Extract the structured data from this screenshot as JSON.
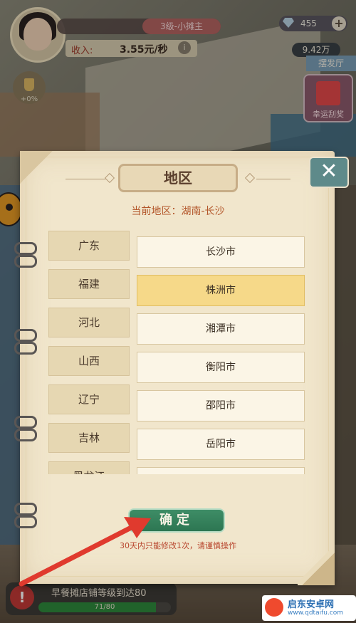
{
  "hud": {
    "level_label": "3级-小摊主",
    "income_label": "收入:",
    "income_value": "3.55元/秒",
    "info_icon": "i",
    "gems": "455",
    "plus": "+",
    "coins": "9.42万",
    "shop_sign": "摆发厅",
    "lucky_label": "幸运刮奖",
    "trophy_pct": "+0%"
  },
  "task": {
    "icon": "!",
    "text": "早餐摊店铺等级到达80",
    "progress_text": "71/80",
    "progress_fraction": 0.8875
  },
  "dialog": {
    "title": "地区",
    "close": "✕",
    "current_area": "当前地区：湖南-长沙",
    "provinces": [
      "广东",
      "福建",
      "河北",
      "山西",
      "辽宁",
      "吉林",
      "黑龙江"
    ],
    "cities": [
      "长沙市",
      "株洲市",
      "湘潭市",
      "衡阳市",
      "邵阳市",
      "岳阳市",
      ""
    ],
    "selected_city_index": 1,
    "confirm": "确定",
    "warning": "30天内只能修改1次，请谨慎操作"
  },
  "watermark": {
    "name": "启东安卓网",
    "url": "www.qdtaifu.com"
  },
  "colors": {
    "accent_green": "#2d7652",
    "selected_city": "#f6d989",
    "arrow_red": "#e03a2e"
  }
}
